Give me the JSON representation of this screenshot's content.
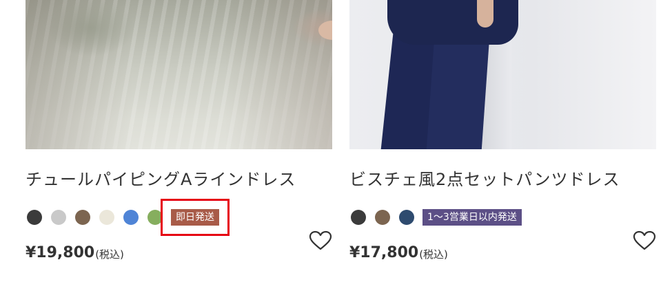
{
  "products": [
    {
      "name": "チュールパイピングAラインドレス",
      "colors": [
        "#3b3b3b",
        "#c9c9c9",
        "#7c6550",
        "#ebe7da",
        "#4f84d6",
        "#86ae5e"
      ],
      "badge": {
        "label": "即日発送",
        "bg": "#a85b48"
      },
      "price": "¥19,800",
      "tax_label": "(税込)",
      "favorite_icon": "heart-outline-icon"
    },
    {
      "name": "ビスチェ風2点セットパンツドレス",
      "colors": [
        "#3b3b3b",
        "#7c6550",
        "#2e4b6f"
      ],
      "badge": {
        "label": "1〜3営業日以内発送",
        "bg": "#5c4f86"
      },
      "price": "¥17,800",
      "tax_label": "(税込)",
      "favorite_icon": "heart-outline-icon"
    }
  ],
  "highlight_color": "#e60012"
}
